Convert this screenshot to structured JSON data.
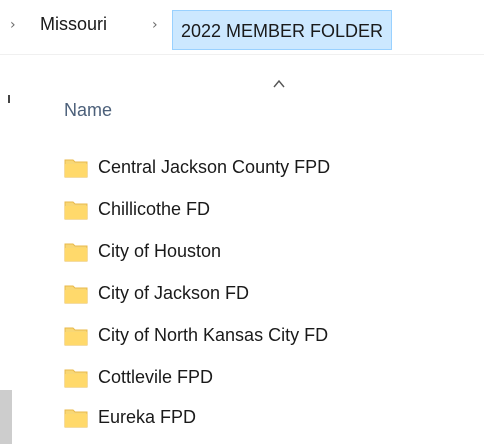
{
  "breadcrumb": {
    "items": [
      "Missouri",
      "2022 MEMBER FOLDER"
    ]
  },
  "columns": {
    "name_header": "Name"
  },
  "files": [
    {
      "name": "Central Jackson County FPD",
      "icon": "folder-icon"
    },
    {
      "name": "Chillicothe FD",
      "icon": "folder-icon"
    },
    {
      "name": "City of Houston",
      "icon": "folder-icon"
    },
    {
      "name": "City of Jackson FD",
      "icon": "folder-icon"
    },
    {
      "name": "City of North Kansas City FD",
      "icon": "folder-icon"
    },
    {
      "name": "Cottlevile FPD",
      "icon": "folder-icon"
    },
    {
      "name": "Eureka FPD",
      "icon": "folder-icon"
    }
  ],
  "colors": {
    "folder": "#f8d775",
    "folder_dark": "#e8b84a",
    "selected_bg": "#cce8ff",
    "selected_border": "#99d1ff",
    "header_text": "#4c607a"
  }
}
